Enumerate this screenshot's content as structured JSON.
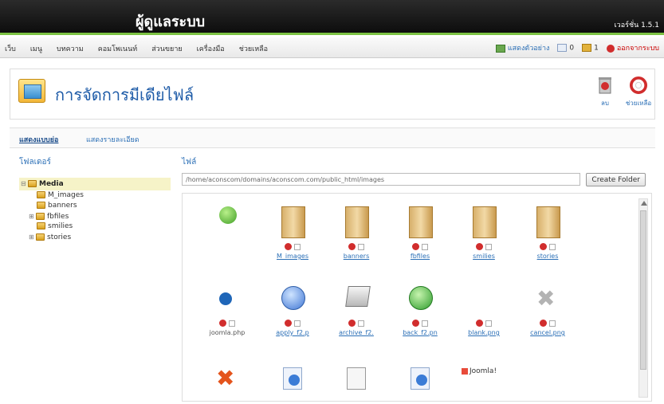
{
  "app": {
    "title": "ผู้ดูแลระบบ",
    "version": "เวอร์ชั่น 1.5.1"
  },
  "menu": [
    "เว็บ",
    "เมนู",
    "บทความ",
    "คอมโพเนนท์",
    "ส่วนขยาย",
    "เครื่องมือ",
    "ช่วยเหลือ"
  ],
  "status": {
    "preview": "แสดงตัวอย่าง",
    "messages": "0",
    "users": "1",
    "logout": "ออกจากระบบ"
  },
  "header": {
    "title": "การจัดการมีเดียไฟล์",
    "delete_label": "ลบ",
    "help_label": "ช่วยเหลือ"
  },
  "subnav": {
    "thumbnail_view": "แสดงแบบย่อ",
    "detail_view": "แสดงรายละเอียด"
  },
  "sidebar": {
    "title": "โฟลเดอร์",
    "root": "Media",
    "children": [
      "M_images",
      "banners",
      "fbfiles",
      "smilies",
      "stories"
    ]
  },
  "files": {
    "title": "ไฟล์",
    "path": "/home/aconscom/domains/aconscom.com/public_html/images",
    "create_folder": "Create Folder",
    "row1": [
      "M_images",
      "banners",
      "fbfiles",
      "smilies",
      "stories"
    ],
    "row2": [
      "joomla.php",
      "apply_f2.p",
      "archive_f2.",
      "back_f2.pn",
      "blank.png",
      "cancel.png"
    ],
    "joomla_text": "Joomla!"
  },
  "colors": {
    "accent_green": "#7cc243",
    "link_blue": "#2b6fb6",
    "title_blue": "#1f5ca8"
  }
}
